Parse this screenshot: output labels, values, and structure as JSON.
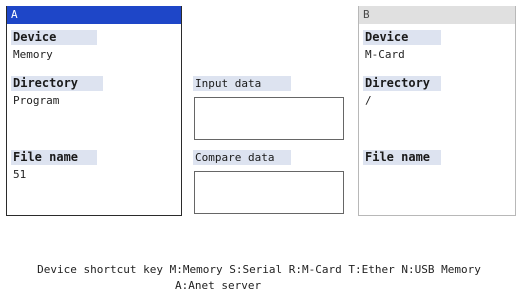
{
  "pane_a": {
    "header": "A",
    "device_label": "Device",
    "device_value": "Memory",
    "directory_label": "Directory",
    "directory_value": "Program",
    "filename_label": "File name",
    "filename_value": "51"
  },
  "middle": {
    "input_label": "Input data",
    "input_value": "",
    "compare_label": "Compare data",
    "compare_value": ""
  },
  "pane_b": {
    "header": "B",
    "device_label": "Device",
    "device_value": "M-Card",
    "directory_label": "Directory",
    "directory_value": "/",
    "filename_label": "File name",
    "filename_value": ""
  },
  "footer": {
    "line1": "Device shortcut key M:Memory S:Serial R:M-Card T:Ether N:USB Memory",
    "line2": "A:Anet server"
  },
  "colors": {
    "active_header": "#1e46c8",
    "inactive_header": "#e0e0e0",
    "label_bg": "#dde3f0"
  }
}
